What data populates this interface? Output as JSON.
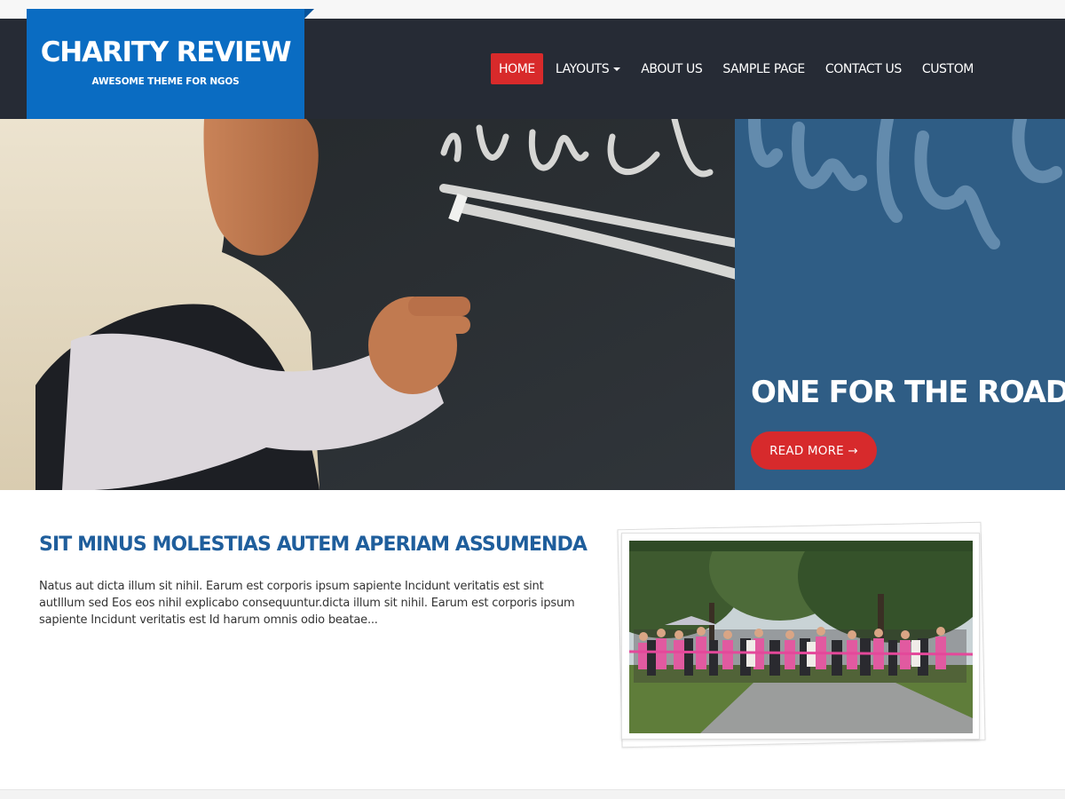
{
  "site": {
    "title": "CHARITY REVIEW",
    "tagline": "AWESOME THEME FOR NGOS"
  },
  "nav": {
    "items": [
      {
        "label": "HOME",
        "active": true
      },
      {
        "label": "LAYOUTS",
        "dropdown": true
      },
      {
        "label": "ABOUT US"
      },
      {
        "label": "SAMPLE PAGE"
      },
      {
        "label": "CONTACT US"
      },
      {
        "label": "CUSTOM"
      }
    ]
  },
  "hero": {
    "title": "ONE FOR THE ROAD...",
    "button_label": "READ MORE →"
  },
  "post": {
    "title": "SIT MINUS MOLESTIAS AUTEM APERIAM ASSUMENDA",
    "excerpt": "Natus aut dicta illum sit nihil. Earum est corporis ipsum sapiente Incidunt veritatis est sint autIllum sed Eos eos nihil explicabo consequuntur.dicta illum sit nihil. Earum est corporis ipsum sapiente Incidunt veritatis est Id harum omnis odio beatae..."
  },
  "colors": {
    "header_bg": "#262b35",
    "logo_bg": "#0a6cc2",
    "accent_red": "#d82a2b",
    "hero_panel_blue": "#2f5d85",
    "post_title_blue": "#1f5e9c"
  }
}
